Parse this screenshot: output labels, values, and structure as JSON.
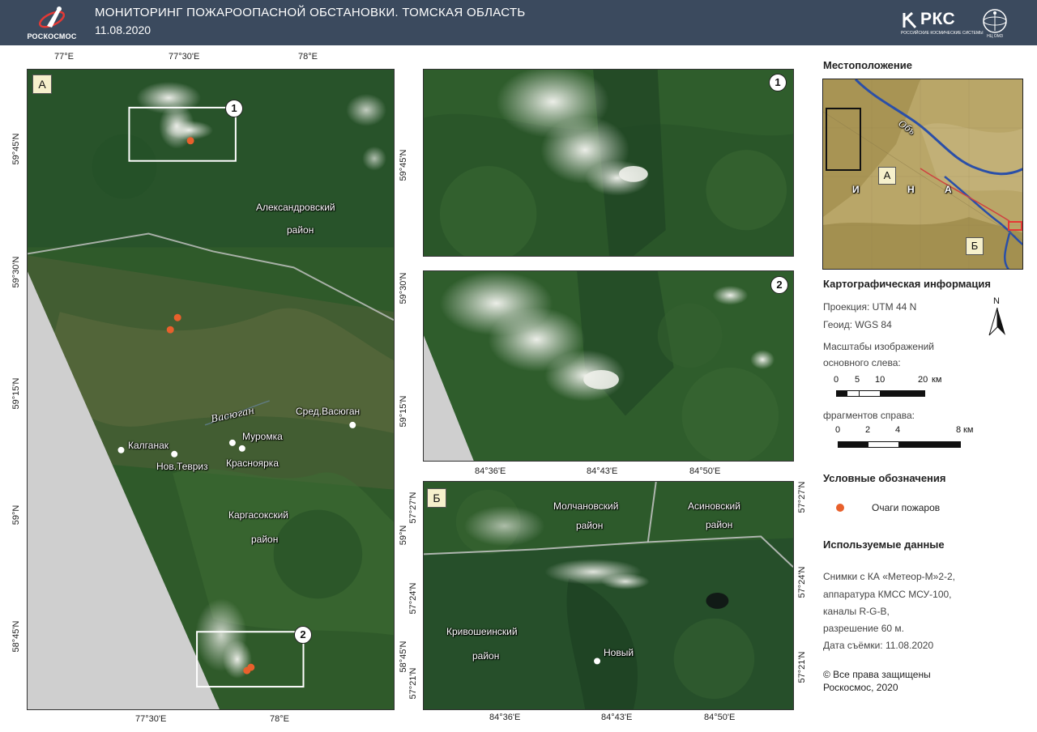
{
  "header": {
    "logo_text": "РОСКОСМОС",
    "title": "МОНИТОРИНГ ПОЖАРООПАСНОЙ ОБСТАНОВКИ. ТОМСКАЯ ОБЛАСТЬ",
    "date": "11.08.2020",
    "rks_logo": "РКС",
    "rks_sub": "РОССИЙСКИЕ КОСМИЧЕСКИЕ СИСТЕМЫ",
    "ntso_sub": "НЦ ОМЗ"
  },
  "map_a": {
    "panel_letter": "А",
    "top_lon": [
      "77°E",
      "77°30'E",
      "78°E"
    ],
    "bottom_lon": [
      "77°30'E",
      "78°E"
    ],
    "left_lat": [
      "59°45'N",
      "59°30'N",
      "59°15'N",
      "59°N",
      "58°45'N"
    ],
    "right_lat": [
      "59°45'N",
      "59°30'N",
      "59°15'N",
      "59°N",
      "58°45'N"
    ],
    "frame_1": "1",
    "frame_2": "2",
    "region_1_line1": "Александровский",
    "region_1_line2": "район",
    "region_2_line1": "Каргасокский",
    "region_2_line2": "район",
    "river": "Васюган",
    "settlements": [
      "Сред.Васюган",
      "Муромка",
      "Калганак",
      "Нов.Тевриз",
      "Красноярка"
    ]
  },
  "map_1": {
    "number": "1"
  },
  "map_2": {
    "number": "2"
  },
  "map_b": {
    "panel_letter": "Б",
    "top_lon": [
      "84°36'E",
      "84°43'E",
      "84°50'E"
    ],
    "bottom_lon": [
      "84°36'E",
      "84°43'E",
      "84°50'E"
    ],
    "left_lat": [
      "57°27'N",
      "57°24'N",
      "57°21'N"
    ],
    "right_lat": [
      "57°27'N",
      "57°24'N",
      "57°21'N"
    ],
    "region_1_line1": "Молчановский",
    "region_1_line2": "район",
    "region_2_line1": "Асиновский",
    "region_2_line2": "район",
    "region_3_line1": "Кривошеинский",
    "region_3_line2": "район",
    "settlement": "Новый"
  },
  "legend": {
    "location_title": "Местоположение",
    "inset_labels": {
      "a": "А",
      "b": "Б",
      "ob": "Обь",
      "i": "И",
      "n": "Н",
      "a2": "А"
    },
    "carto_title": "Картографическая информация",
    "projection": "Проекция: UTM 44 N",
    "geoid": "Геоид: WGS 84",
    "north": "N",
    "scales_line1": "Масштабы изображений",
    "scales_line2": "основного слева:",
    "scale_main": [
      "0",
      "5",
      "10",
      "20"
    ],
    "scale_unit": "км",
    "fragments_label": "фрагментов справа:",
    "scale_frag": [
      "0",
      "2",
      "4",
      "8"
    ],
    "symbols_title": "Условные обозначения",
    "fire_label": "Очаги пожаров",
    "fire_color": "#e8602c",
    "data_title": "Используемые данные",
    "data_lines": [
      "Снимки с КА «Метеор-М»2-2,",
      "аппаратура КМСС МСУ-100,",
      "каналы R-G-B,",
      "разрешение 60 м.",
      "Дата съёмки: 11.08.2020"
    ],
    "copyright_1": "© Все права защищены",
    "copyright_2": "Роскосмос, 2020"
  }
}
